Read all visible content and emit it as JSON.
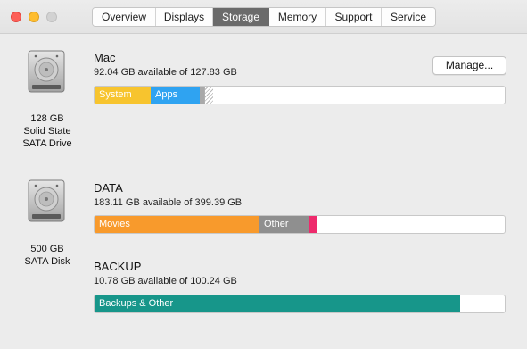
{
  "window": {
    "tabs": [
      "Overview",
      "Displays",
      "Storage",
      "Memory",
      "Support",
      "Service"
    ],
    "active_tab": "Storage"
  },
  "drives": [
    {
      "label_lines": [
        "128 GB",
        "Solid State",
        "SATA Drive"
      ],
      "icon": "hard-drive-icon",
      "volumes": [
        {
          "name": "Mac",
          "info": "92.04 GB available of 127.83 GB",
          "segments": [
            {
              "label": "System",
              "fraction": 0.137,
              "color": "#f7c42e"
            },
            {
              "label": "Apps",
              "fraction": 0.12,
              "color": "#2fa3f1"
            },
            {
              "label": "",
              "fraction": 0.011,
              "color": "#a9a9a9"
            },
            {
              "label": "",
              "fraction": 0.021,
              "color": "hatched"
            }
          ]
        }
      ]
    },
    {
      "label_lines": [
        "500 GB",
        "SATA Disk"
      ],
      "icon": "hard-drive-icon",
      "volumes": [
        {
          "name": "DATA",
          "info": "183.11 GB available of 399.39 GB",
          "segments": [
            {
              "label": "Movies",
              "fraction": 0.403,
              "color": "#f89a2c"
            },
            {
              "label": "Other",
              "fraction": 0.121,
              "color": "#8f8f8f"
            },
            {
              "label": "",
              "fraction": 0.017,
              "color": "#ee2a6c"
            }
          ]
        },
        {
          "name": "BACKUP",
          "info": "10.78 GB available of 100.24 GB",
          "segments": [
            {
              "label": "Backups & Other",
              "fraction": 0.892,
              "color": "#17968a"
            }
          ]
        }
      ]
    }
  ],
  "manage_button": "Manage..."
}
